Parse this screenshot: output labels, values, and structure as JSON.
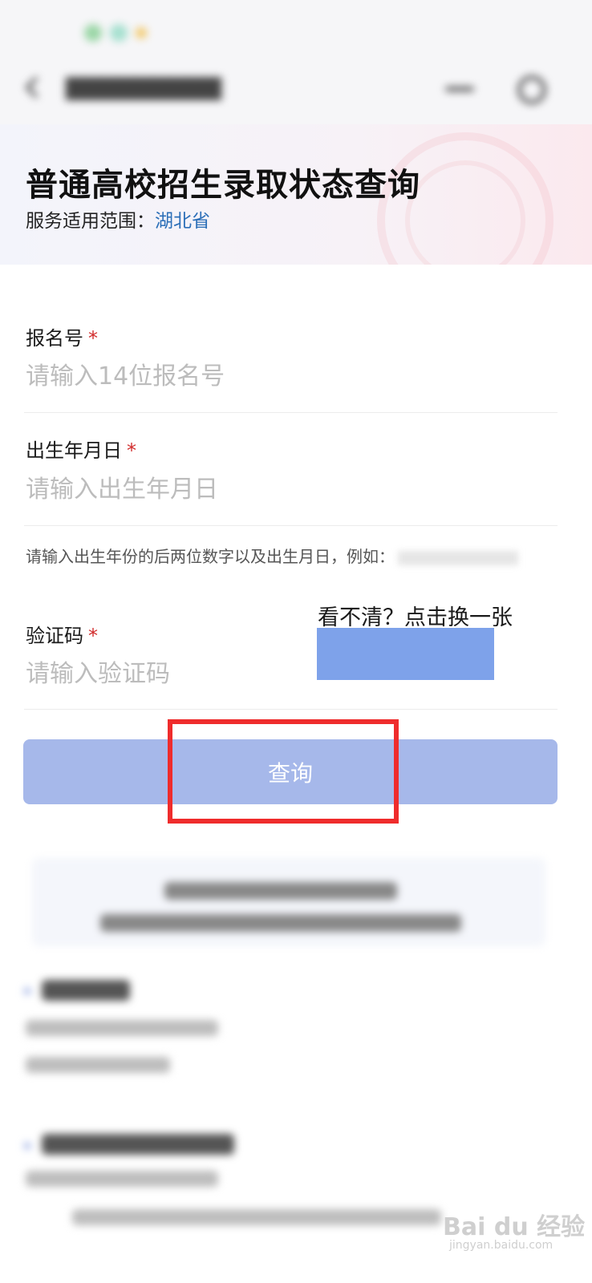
{
  "header": {
    "title": "普通高校招生录取状态查询",
    "scope_label": "服务适用范围：",
    "scope_value": "湖北省"
  },
  "form": {
    "registration": {
      "label": "报名号",
      "required_mark": "*",
      "placeholder": "请输入14位报名号"
    },
    "birthdate": {
      "label": "出生年月日",
      "required_mark": "*",
      "placeholder": "请输入出生年月日",
      "hint": "请输入出生年份的后两位数字以及出生月日，例如："
    },
    "captcha": {
      "label": "验证码",
      "required_mark": "*",
      "placeholder": "请输入验证码",
      "refresh_label": "看不清？点击换一张"
    },
    "submit_label": "查询"
  },
  "watermark": {
    "text": "Bai du 经验",
    "sub": "jingyan.baidu.com"
  },
  "colors": {
    "accent_link": "#2c6fb8",
    "button": "#a6b8ea",
    "required": "#d12b2b",
    "highlight": "#ef2c2c"
  }
}
